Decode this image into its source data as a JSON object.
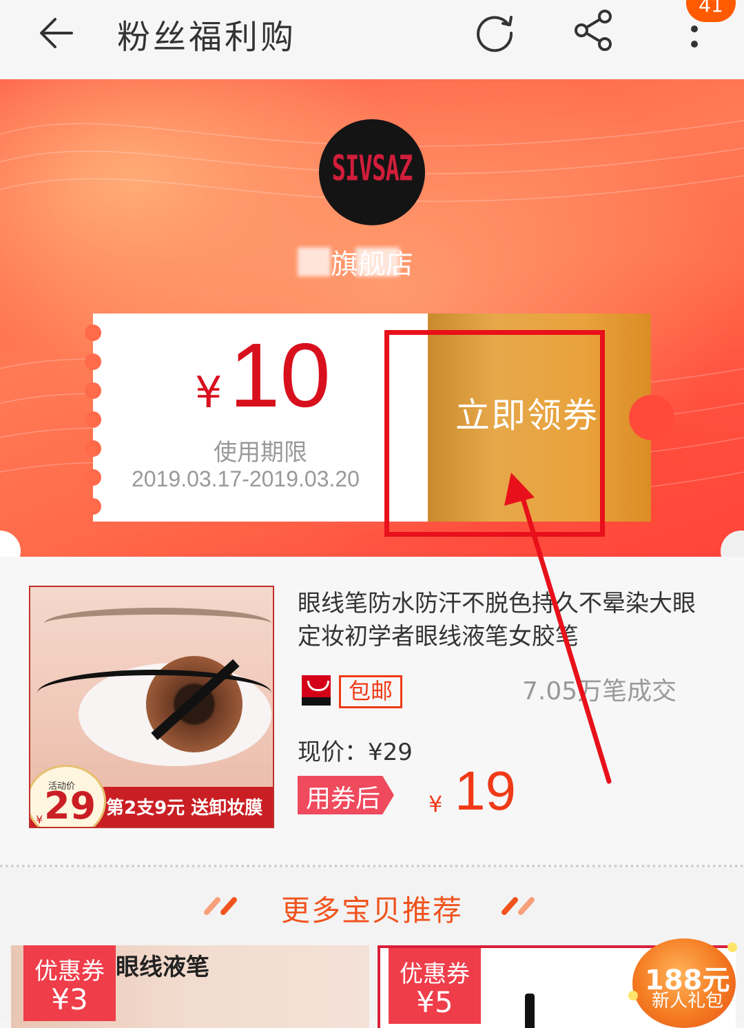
{
  "topbar": {
    "title": "粉丝福利购",
    "badge_count": "41",
    "icons": [
      "back-arrow-icon",
      "refresh-icon",
      "share-icon",
      "more-vertical-icon"
    ]
  },
  "shop": {
    "logo_text": "SIVSAZ",
    "name": "旗舰店"
  },
  "coupon": {
    "currency": "¥",
    "amount": "10",
    "validity_label": "使用期限",
    "validity_dates": "2019.03.17-2019.03.20",
    "claim_label": "立即领券"
  },
  "product": {
    "title": "眼线笔防水防汗不脱色持久不晕染大眼定妆初学者眼线液笔女胶笔",
    "free_shipping": "包邮",
    "sales": "7.05万笔成交",
    "current_price": "现价：¥29",
    "after_coupon_label": "用券后",
    "final_currency": "¥",
    "final_price": "19",
    "image": {
      "activity_label": "活动价",
      "currency": "¥",
      "price": "29",
      "promo": "第2支9元 送卸妆膜"
    }
  },
  "recommend": {
    "title": "更多宝贝推荐",
    "cards": [
      {
        "tag": "优惠券",
        "value": "¥3",
        "title": "眼线液笔"
      },
      {
        "tag": "优惠券",
        "value": "¥5"
      }
    ]
  },
  "gift": {
    "amount": "188元",
    "label": "新人礼包"
  },
  "colors": {
    "accent_red": "#d8101e",
    "orange": "#f0531d",
    "coupon_gold": "#e6a84a",
    "annotation_red": "#e8101a"
  }
}
